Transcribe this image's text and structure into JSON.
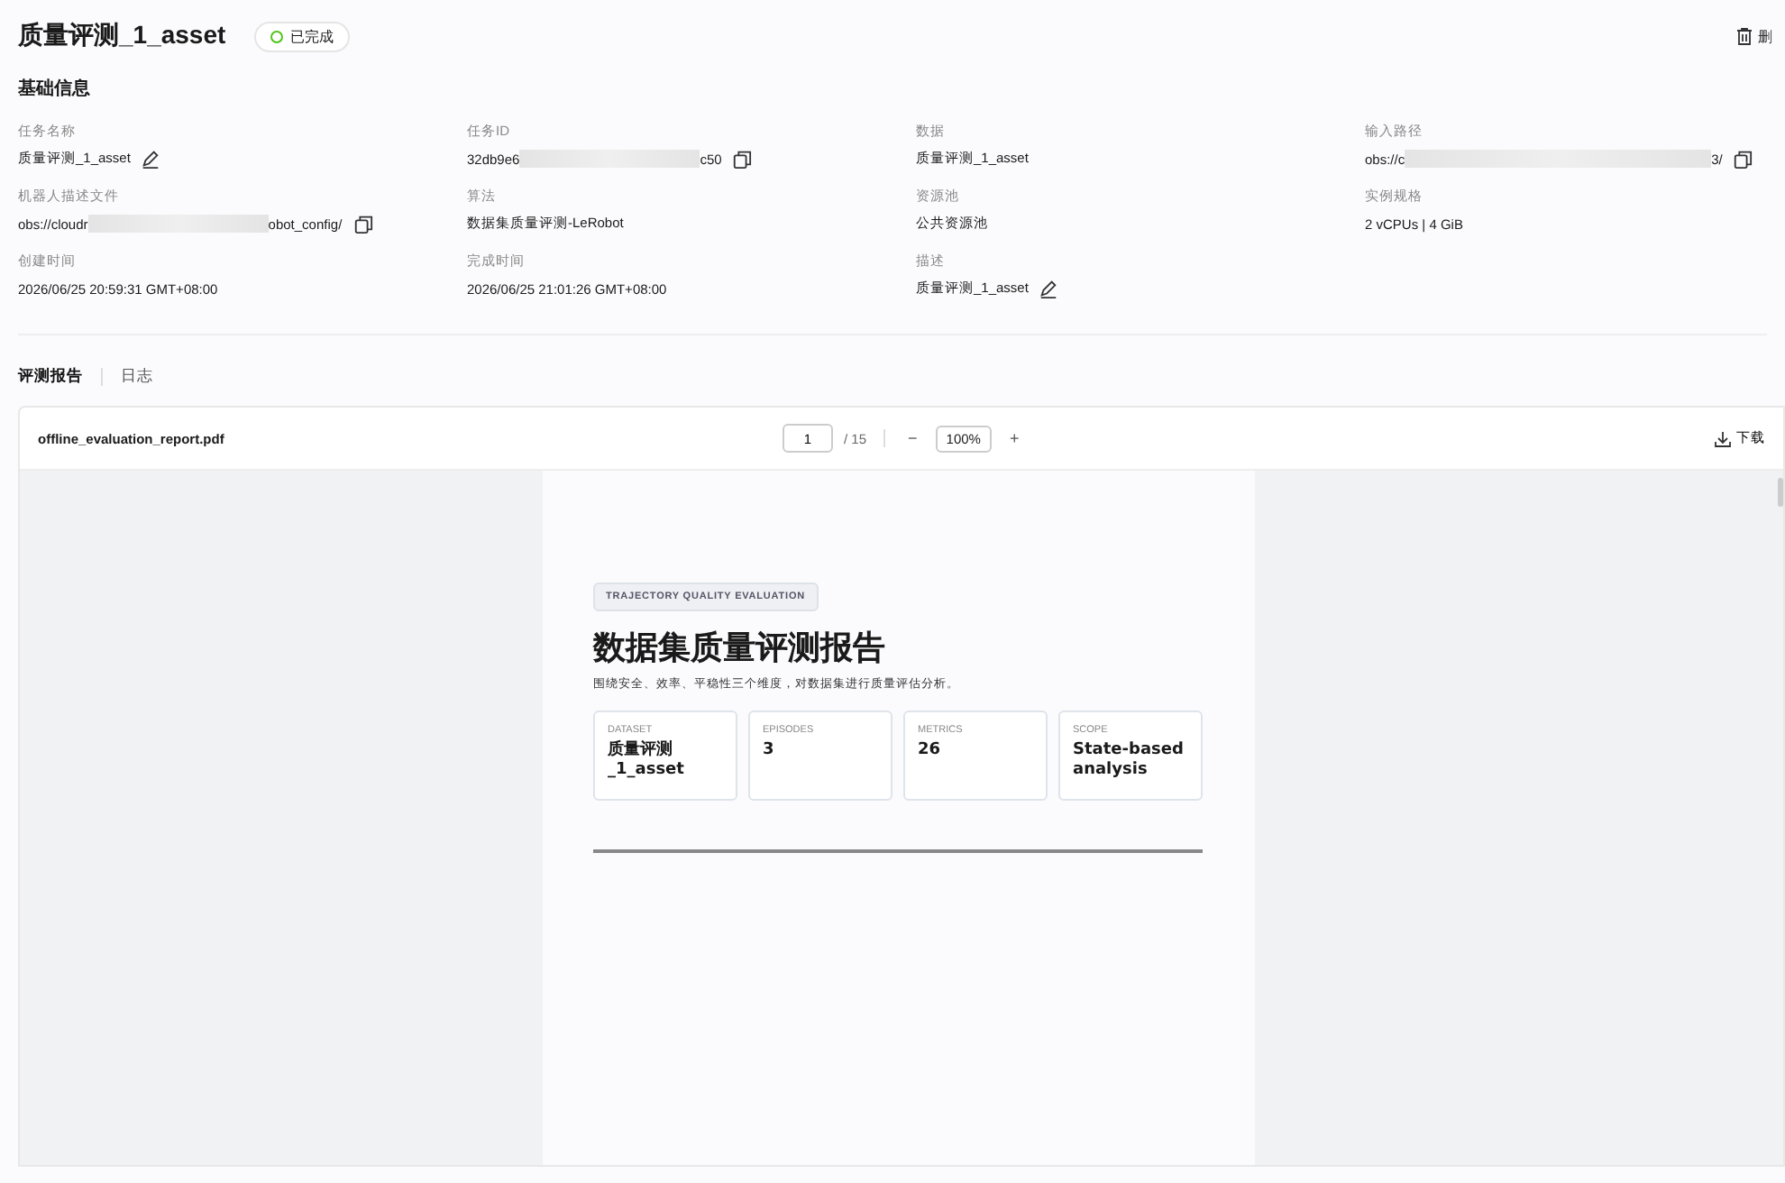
{
  "header": {
    "title": "质量评测_1_asset",
    "status": {
      "label": "已完成",
      "color": "#52c41a"
    },
    "delete_button": "删"
  },
  "basic_info": {
    "title": "基础信息",
    "fields": [
      {
        "label": "任务名称",
        "value": "质量评测_1_asset",
        "kind": "editable"
      },
      {
        "label": "任务ID",
        "kind": "masked",
        "value_start": "32db9e6",
        "value_end": "c50"
      },
      {
        "label": "数据",
        "value": "质量评测_1_asset",
        "kind": "plain"
      },
      {
        "label": "输入路径",
        "kind": "masked",
        "value_start": "obs://c",
        "value_end": "3/"
      },
      {
        "label": "机器人描述文件",
        "kind": "masked",
        "value_start": "obs://cloudr",
        "value_end": "obot_config/"
      },
      {
        "label": "算法",
        "value": "数据集质量评测-LeRobot",
        "kind": "plain"
      },
      {
        "label": "资源池",
        "value": "公共资源池",
        "kind": "plain"
      },
      {
        "label": "实例规格",
        "value": "2 vCPUs | 4 GiB",
        "kind": "plain"
      },
      {
        "label": "创建时间",
        "value": "2026/06/25 20:59:31 GMT+08:00",
        "kind": "plain"
      },
      {
        "label": "完成时间",
        "value": "2026/06/25 21:01:26 GMT+08:00",
        "kind": "plain"
      },
      {
        "label": "描述",
        "value": "质量评测_1_asset",
        "kind": "editable"
      }
    ]
  },
  "tabs": [
    {
      "label": "评测报告",
      "selected": true
    },
    {
      "label": "日志",
      "selected": false
    }
  ],
  "pdf_viewer": {
    "file_name": "offline_evaluation_report.pdf",
    "page": "1",
    "page_total": "/ 15",
    "zoom_out": "−",
    "zoom": "100%",
    "zoom_in": "+",
    "download": "下载",
    "page_content": {
      "badge": "TRAJECTORY QUALITY EVALUATION",
      "title": "数据集质量评测报告",
      "subtitle": "围绕安全、效率、平稳性三个维度，对数据集进行质量评估分析。",
      "cards": [
        {
          "label": "DATASET",
          "value": "质量评测_1_asset"
        },
        {
          "label": "EPISODES",
          "value": "3"
        },
        {
          "label": "METRICS",
          "value": "26"
        },
        {
          "label": "SCOPE",
          "value": "State-based analysis"
        }
      ]
    }
  }
}
